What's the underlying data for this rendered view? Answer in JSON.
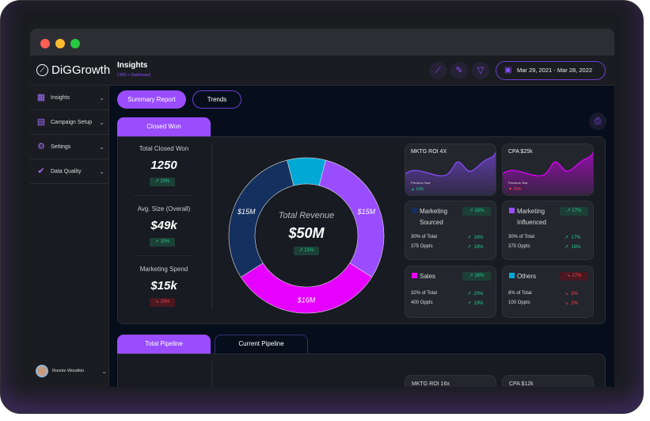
{
  "brand": "DiGGrowth",
  "header": {
    "title": "Insights",
    "breadcrumb": "CMO > Dashboard",
    "date_range": "Mar 29, 2021 - Mar 28, 2022",
    "icons": [
      "chart-line-icon",
      "pin-icon",
      "filter-icon",
      "calendar-icon"
    ]
  },
  "sidebar": {
    "items": [
      {
        "label": "Insights",
        "icon": "grid-icon"
      },
      {
        "label": "Campaign Setup",
        "icon": "campaign-icon"
      },
      {
        "label": "Settings",
        "icon": "gear-icon"
      },
      {
        "label": "Data Quality",
        "icon": "check-badge-icon"
      }
    ],
    "user": "Ronnie Woodkin"
  },
  "report_tabs": [
    "Summary Report",
    "Trends"
  ],
  "section1": {
    "tab": "Closed Won",
    "kpis": [
      {
        "label": "Total Closed Won",
        "value": "1250",
        "change": "10%",
        "trend": "up"
      },
      {
        "label": "Avg. Size (Overall)",
        "value": "$49k",
        "change": "10%",
        "trend": "up"
      },
      {
        "label": "Marketing Spend",
        "value": "$15k",
        "change": "10%",
        "trend": "down"
      }
    ],
    "spark_cards": [
      {
        "title": "MKTG ROI 4X",
        "sub": "Previous Year",
        "change": "10%",
        "trend": "up",
        "color": "#8b4dff"
      },
      {
        "title": "CPA $25k",
        "sub": "Previous Year",
        "change": "20%",
        "trend": "down",
        "color": "#e100ff"
      }
    ],
    "segments": [
      {
        "name": "Marketing",
        "name2": "Sourced",
        "color": "#14305e",
        "badge": "16%",
        "badge_trend": "up",
        "rows": [
          [
            "30% of Total",
            "16%",
            "up"
          ],
          [
            "375 Oppts",
            "18%",
            "up"
          ]
        ]
      },
      {
        "name": "Marketing",
        "name2": "Influenced",
        "color": "#9a4dff",
        "badge": "17%",
        "badge_trend": "up",
        "rows": [
          [
            "30% of Total",
            "17%",
            "up"
          ],
          [
            "375 Oppts",
            "16%",
            "up"
          ]
        ]
      },
      {
        "name": "Sales",
        "name2": "",
        "color": "#e600ff",
        "badge": "16%",
        "badge_trend": "up",
        "rows": [
          [
            "32% of Total",
            "20%",
            "up"
          ],
          [
            "400 Oppts",
            "19%",
            "up"
          ]
        ]
      },
      {
        "name": "Others",
        "name2": "",
        "color": "#00a8d6",
        "badge": "17%",
        "badge_trend": "down",
        "rows": [
          [
            "8% of Total",
            "3%",
            "down"
          ],
          [
            "100 Oppts",
            "2%",
            "down"
          ]
        ]
      }
    ]
  },
  "chart_data": {
    "type": "pie",
    "center_title": "Total Revenue",
    "center_value": "$50M",
    "center_change": "21%",
    "slices": [
      {
        "label": "",
        "value": 4,
        "color": "#00a8d6"
      },
      {
        "label": "$15M",
        "value": 15,
        "color": "#9a4dff"
      },
      {
        "label": "$16M",
        "value": 16,
        "color": "#e600ff"
      },
      {
        "label": "$15M",
        "value": 15,
        "color": "#14305e"
      }
    ]
  },
  "section2": {
    "tabs": [
      "Total Pipeline",
      "Current Pipeline"
    ],
    "spark_cards": [
      "MKTG ROI 16x",
      "CPA $12k"
    ]
  }
}
